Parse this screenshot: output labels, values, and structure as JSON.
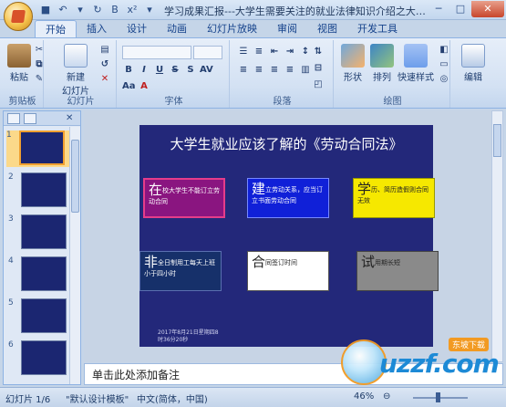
{
  "window": {
    "title": "学习成果汇报---大学生需要关注的就业法律知识介绍之大学生就业应该..."
  },
  "tabs": [
    "开始",
    "插入",
    "设计",
    "动画",
    "幻灯片放映",
    "审阅",
    "视图",
    "开发工具"
  ],
  "ribbon": {
    "clipboard": {
      "paste": "粘贴",
      "group": "剪贴板"
    },
    "slides": {
      "new_slide": "新建",
      "new_slide2": "幻灯片",
      "group": "幻灯片"
    },
    "font": {
      "group": "字体"
    },
    "paragraph": {
      "group": "段落"
    },
    "drawing": {
      "shapes": "形状",
      "arrange": "排列",
      "quick_styles": "快速样式",
      "group": "绘图"
    },
    "editing": {
      "label": "编辑"
    }
  },
  "slide": {
    "title": "大学生就业应该了解的《劳动合同法》",
    "boxes": [
      {
        "big": "在",
        "text": "校大学生不能订立劳动合同",
        "bg": "#8a1580",
        "fg": "#ffffff"
      },
      {
        "big": "建",
        "text": "立劳动关系，应当订立书面劳动合同",
        "bg": "#1020d8",
        "fg": "#ffffff"
      },
      {
        "big": "学",
        "text": "历、简历造假则合同无效",
        "bg": "#f6e800",
        "fg": "#222222"
      },
      {
        "big": "非",
        "text": "全日制用工每天上班小于四小时",
        "bg": "#16306a",
        "fg": "#ffffff"
      },
      {
        "big": "合",
        "text": "同签订时间",
        "bg": "#ffffff",
        "fg": "#222222"
      },
      {
        "big": "试",
        "text": "用期长短",
        "bg": "#8a8a8a",
        "fg": "#222222"
      }
    ],
    "footer": "2017年8月21日星期四8时36分20秒"
  },
  "thumbnails": [
    "1",
    "2",
    "3",
    "4",
    "5",
    "6"
  ],
  "notes": {
    "placeholder": "单击此处添加备注"
  },
  "status": {
    "slide_info": "幻灯片 1/6",
    "theme": "\"默认设计模板\"",
    "language": "中文(简体，中国)",
    "zoom": "46%"
  },
  "watermark": {
    "text": "uzzf.com",
    "tag": "东坡下载"
  },
  "colors": {
    "slide_bg": "#23287a",
    "ribbon_border": "#8db2e3"
  }
}
